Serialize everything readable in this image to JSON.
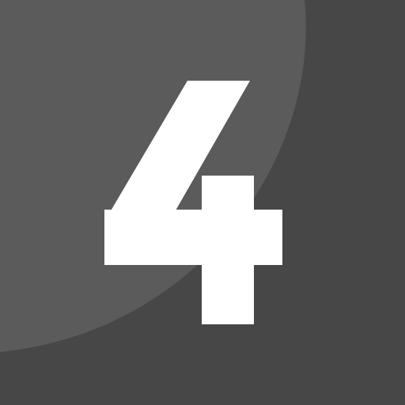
{
  "icon": {
    "name": "number-four-icon",
    "digit": "4"
  },
  "colors": {
    "background": "#474747",
    "highlight": "#5b5b5b",
    "digit": "#ffffff"
  }
}
